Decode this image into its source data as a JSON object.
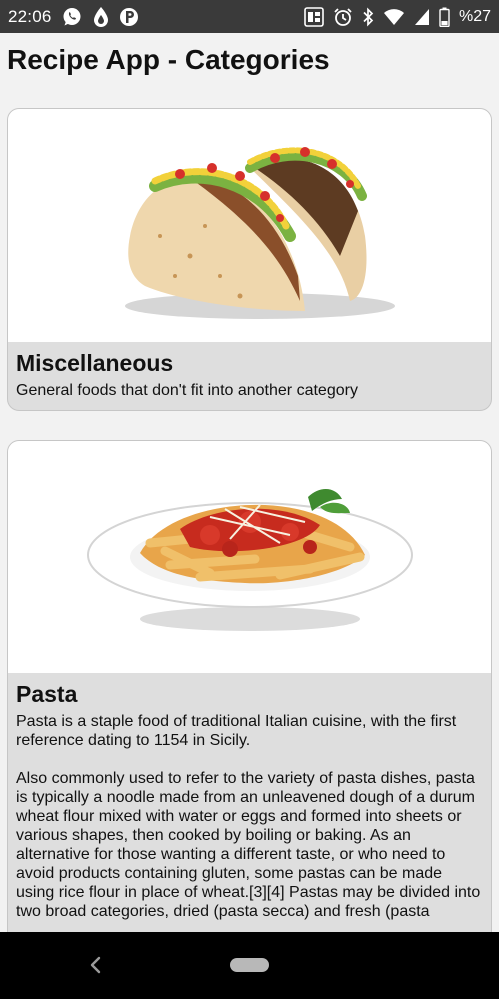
{
  "status_bar": {
    "time": "22:06",
    "battery": "%27",
    "left_icons": [
      "whatsapp-icon",
      "drop-icon",
      "p-badge-icon"
    ],
    "right_icons": [
      "volte-icon",
      "alarm-icon",
      "bluetooth-icon",
      "wifi-icon",
      "signal-icon",
      "battery-icon"
    ]
  },
  "app": {
    "title": "Recipe App - Categories"
  },
  "categories": [
    {
      "title": "Miscellaneous",
      "image": "tacos",
      "description": [
        "General foods that don't fit into another category"
      ]
    },
    {
      "title": "Pasta",
      "image": "penne pasta",
      "description": [
        "Pasta is a staple food of traditional Italian cuisine, with the first reference dating to 1154 in Sicily.",
        "Also commonly used to refer to the variety of pasta dishes, pasta is typically a noodle made from an unleavened dough of a durum wheat flour mixed with water or eggs and formed into sheets or various shapes, then cooked by boiling or baking. As an alternative for those wanting a different taste, or who need to avoid products containing gluten, some pastas can be made using rice flour in place of wheat.[3][4] Pastas may be divided into two broad categories, dried (pasta secca) and fresh (pasta"
      ]
    }
  ],
  "nav_bar": {
    "icons": [
      "back-icon",
      "home-pill-icon"
    ]
  },
  "colors": {
    "status_bar": "#3a3a3a",
    "page_bg": "#f2f2f2",
    "card_bg": "#dedede",
    "nav_bar": "#000000"
  }
}
